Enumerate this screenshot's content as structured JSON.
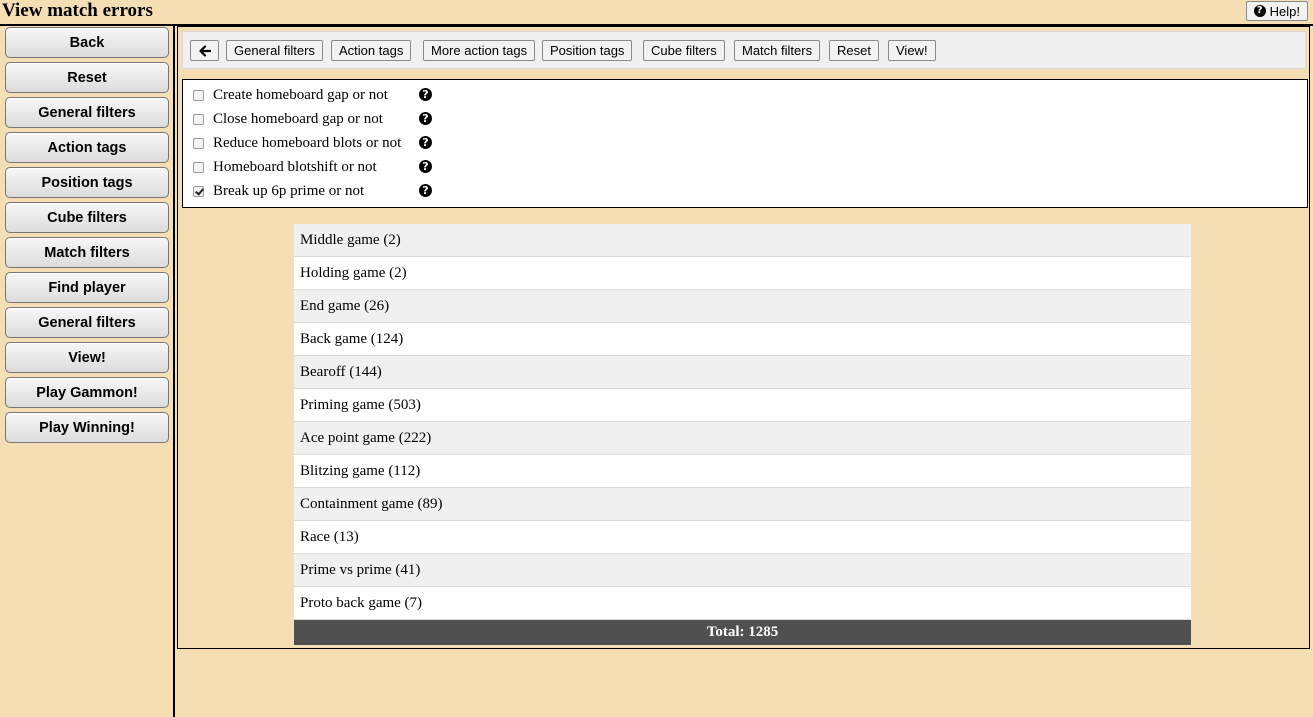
{
  "page": {
    "title": "View match errors",
    "help_label": "Help!"
  },
  "sidebar": {
    "items": [
      {
        "label": "Back"
      },
      {
        "label": "Reset"
      },
      {
        "label": "General filters"
      },
      {
        "label": "Action tags"
      },
      {
        "label": "Position tags"
      },
      {
        "label": "Cube filters"
      },
      {
        "label": "Match filters"
      },
      {
        "label": "Find player"
      },
      {
        "label": "General filters"
      },
      {
        "label": "View!"
      },
      {
        "label": "Play Gammon!"
      },
      {
        "label": "Play Winning!"
      }
    ]
  },
  "toolbar": {
    "back_icon": "arrow-left-icon",
    "buttons": [
      {
        "label": "General filters"
      },
      {
        "label": "Action tags"
      },
      {
        "label": "More action tags"
      },
      {
        "label": "Position tags"
      },
      {
        "label": "Cube filters"
      },
      {
        "label": "Match filters"
      },
      {
        "label": "Reset"
      },
      {
        "label": "View!"
      }
    ]
  },
  "filters": {
    "help_icon": "question-circle-icon",
    "items": [
      {
        "label": "Create homeboard gap or not",
        "checked": false
      },
      {
        "label": "Close homeboard gap or not",
        "checked": false
      },
      {
        "label": "Reduce homeboard blots or not",
        "checked": false
      },
      {
        "label": "Homeboard blotshift or not",
        "checked": false
      },
      {
        "label": "Break up 6p prime or not",
        "checked": true
      }
    ]
  },
  "categories": {
    "rows": [
      {
        "label": "Middle game (2)"
      },
      {
        "label": "Holding game (2)"
      },
      {
        "label": "End game (26)"
      },
      {
        "label": "Back game (124)"
      },
      {
        "label": "Bearoff (144)"
      },
      {
        "label": "Priming game (503)"
      },
      {
        "label": "Ace point game (222)"
      },
      {
        "label": "Blitzing game (112)"
      },
      {
        "label": "Containment game (89)"
      },
      {
        "label": "Race (13)"
      },
      {
        "label": "Prime vs prime (41)"
      },
      {
        "label": "Proto back game (7)"
      }
    ],
    "total": "Total: 1285"
  },
  "colors": {
    "background": "#f5deb3",
    "total_bar": "#505050",
    "row_alt": "#f0f0f0"
  }
}
